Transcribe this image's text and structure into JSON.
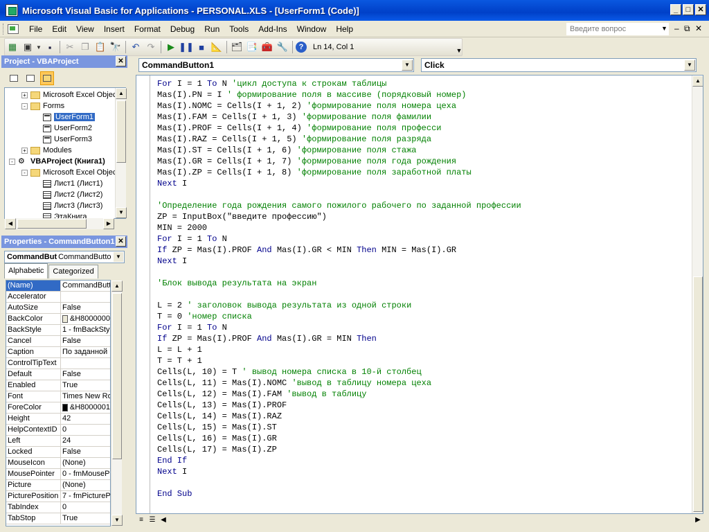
{
  "window": {
    "title": "Microsoft Visual Basic for Applications - PERSONAL.XLS - [UserForm1 (Code)]"
  },
  "menu": [
    "File",
    "Edit",
    "View",
    "Insert",
    "Format",
    "Debug",
    "Run",
    "Tools",
    "Add-Ins",
    "Window",
    "Help"
  ],
  "help_box": {
    "placeholder": "Введите вопрос"
  },
  "toolbar": {
    "position": "Ln 14, Col 1"
  },
  "project_panel": {
    "title": "Project - VBAProject",
    "tree": [
      {
        "label": "Microsoft Excel Objec",
        "type": "folder",
        "level": 1,
        "toggle": "+"
      },
      {
        "label": "Forms",
        "type": "folder",
        "level": 1,
        "toggle": "-"
      },
      {
        "label": "UserForm1",
        "type": "form",
        "level": 2,
        "selected": true
      },
      {
        "label": "UserForm2",
        "type": "form",
        "level": 2
      },
      {
        "label": "UserForm3",
        "type": "form",
        "level": 2
      },
      {
        "label": "Modules",
        "type": "folder",
        "level": 1,
        "toggle": "+"
      },
      {
        "label": "VBAProject (Книга1)",
        "type": "project",
        "level": 0,
        "toggle": "-",
        "bold": true
      },
      {
        "label": "Microsoft Excel Objec",
        "type": "folder",
        "level": 1,
        "toggle": "-"
      },
      {
        "label": "Лист1 (Лист1)",
        "type": "sheet",
        "level": 2
      },
      {
        "label": "Лист2 (Лист2)",
        "type": "sheet",
        "level": 2
      },
      {
        "label": "Лист3 (Лист3)",
        "type": "sheet",
        "level": 2
      },
      {
        "label": "ЭтаКнига",
        "type": "sheet",
        "level": 2
      }
    ]
  },
  "properties_panel": {
    "title": "Properties - CommandButton1",
    "object_name": "CommandBut",
    "object_type": "CommandButto",
    "tabs": [
      "Alphabetic",
      "Categorized"
    ],
    "rows": [
      {
        "name": "(Name)",
        "value": "CommandButt",
        "selected": true
      },
      {
        "name": "Accelerator",
        "value": ""
      },
      {
        "name": "AutoSize",
        "value": "False"
      },
      {
        "name": "BackColor",
        "value": "&H8000000",
        "swatch": "#ece9d8"
      },
      {
        "name": "BackStyle",
        "value": "1 - fmBackStyle"
      },
      {
        "name": "Cancel",
        "value": "False"
      },
      {
        "name": "Caption",
        "value": "По заданной п"
      },
      {
        "name": "ControlTipText",
        "value": ""
      },
      {
        "name": "Default",
        "value": "False"
      },
      {
        "name": "Enabled",
        "value": "True"
      },
      {
        "name": "Font",
        "value": "Times New Ror"
      },
      {
        "name": "ForeColor",
        "value": "&H8000001",
        "swatch": "#000000"
      },
      {
        "name": "Height",
        "value": "42"
      },
      {
        "name": "HelpContextID",
        "value": "0"
      },
      {
        "name": "Left",
        "value": "24"
      },
      {
        "name": "Locked",
        "value": "False"
      },
      {
        "name": "MouseIcon",
        "value": "(None)"
      },
      {
        "name": "MousePointer",
        "value": "0 - fmMousePo"
      },
      {
        "name": "Picture",
        "value": "(None)"
      },
      {
        "name": "PicturePosition",
        "value": "7 - fmPicturePo"
      },
      {
        "name": "TabIndex",
        "value": "0"
      },
      {
        "name": "TabStop",
        "value": "True"
      }
    ]
  },
  "code_window": {
    "object_combo": "CommandButton1",
    "procedure_combo": "Click",
    "lines": [
      [
        [
          "k",
          "For"
        ],
        [
          "t",
          " I = 1 "
        ],
        [
          "k",
          "To"
        ],
        [
          "t",
          " N "
        ],
        [
          "c",
          "'цикл доступа к строкам таблицы"
        ]
      ],
      [
        [
          "t",
          "Mas(I).PN = I "
        ],
        [
          "c",
          "' формирование поля в массиве (порядковый номер)"
        ]
      ],
      [
        [
          "t",
          "Mas(I).NOMC = Cells(I + 1, 2) "
        ],
        [
          "c",
          "'формирование поля номера цеха"
        ]
      ],
      [
        [
          "t",
          "Mas(I).FAM = Cells(I + 1, 3) "
        ],
        [
          "c",
          "'формирование поля фамилии"
        ]
      ],
      [
        [
          "t",
          "Mas(I).PROF = Cells(I + 1, 4) "
        ],
        [
          "c",
          "'формирование поля професси"
        ]
      ],
      [
        [
          "t",
          "Mas(I).RAZ = Cells(I + 1, 5) "
        ],
        [
          "c",
          "'формирование поля разряда"
        ]
      ],
      [
        [
          "t",
          "Mas(I).ST = Cells(I + 1, 6) "
        ],
        [
          "c",
          "'формирование поля стажа"
        ]
      ],
      [
        [
          "t",
          "Mas(I).GR = Cells(I + 1, 7) "
        ],
        [
          "c",
          "'формирование поля года рождения"
        ]
      ],
      [
        [
          "t",
          "Mas(I).ZP = Cells(I + 1, 8) "
        ],
        [
          "c",
          "'формирование поля заработной платы"
        ]
      ],
      [
        [
          "k",
          "Next"
        ],
        [
          "t",
          " I"
        ]
      ],
      [],
      [
        [
          "c",
          "'Определение года рождения самого пожилого рабочего по заданной профессии"
        ]
      ],
      [
        [
          "t",
          "ZP = InputBox(\"введите профессию\")"
        ]
      ],
      [
        [
          "t",
          "MIN = 2000"
        ]
      ],
      [
        [
          "k",
          "For"
        ],
        [
          "t",
          " I = 1 "
        ],
        [
          "k",
          "To"
        ],
        [
          "t",
          " N"
        ]
      ],
      [
        [
          "k",
          "If"
        ],
        [
          "t",
          " ZP = Mas(I).PROF "
        ],
        [
          "k",
          "And"
        ],
        [
          "t",
          " Mas(I).GR < MIN "
        ],
        [
          "k",
          "Then"
        ],
        [
          "t",
          " MIN = Mas(I).GR"
        ]
      ],
      [
        [
          "k",
          "Next"
        ],
        [
          "t",
          " I"
        ]
      ],
      [],
      [
        [
          "c",
          "'Блок вывода результата на экран"
        ]
      ],
      [],
      [
        [
          "t",
          "L = 2 "
        ],
        [
          "c",
          "' заголовок вывода результата из одной строки"
        ]
      ],
      [
        [
          "t",
          "T = 0 "
        ],
        [
          "c",
          "'номер списка"
        ]
      ],
      [
        [
          "k",
          "For"
        ],
        [
          "t",
          " I = 1 "
        ],
        [
          "k",
          "To"
        ],
        [
          "t",
          " N"
        ]
      ],
      [
        [
          "k",
          "If"
        ],
        [
          "t",
          " ZP = Mas(I).PROF "
        ],
        [
          "k",
          "And"
        ],
        [
          "t",
          " Mas(I).GR = MIN "
        ],
        [
          "k",
          "Then"
        ]
      ],
      [
        [
          "t",
          "L = L + 1"
        ]
      ],
      [
        [
          "t",
          "T = T + 1"
        ]
      ],
      [
        [
          "t",
          "Cells(L, 10) = T "
        ],
        [
          "c",
          "' вывод номера списка в 10-й столбец"
        ]
      ],
      [
        [
          "t",
          "Cells(L, 11) = Mas(I).NOMC "
        ],
        [
          "c",
          "'вывод в таблицу номера цеха"
        ]
      ],
      [
        [
          "t",
          "Cells(L, 12) = Mas(I).FAM "
        ],
        [
          "c",
          "'вывод в таблицу"
        ]
      ],
      [
        [
          "t",
          "Cells(L, 13) = Mas(I).PROF"
        ]
      ],
      [
        [
          "t",
          "Cells(L, 14) = Mas(I).RAZ"
        ]
      ],
      [
        [
          "t",
          "Cells(L, 15) = Mas(I).ST"
        ]
      ],
      [
        [
          "t",
          "Cells(L, 16) = Mas(I).GR"
        ]
      ],
      [
        [
          "t",
          "Cells(L, 17) = Mas(I).ZP"
        ]
      ],
      [
        [
          "k",
          "End If"
        ]
      ],
      [
        [
          "k",
          "Next"
        ],
        [
          "t",
          " I"
        ]
      ],
      [],
      [
        [
          "k",
          "End Sub"
        ]
      ]
    ]
  }
}
